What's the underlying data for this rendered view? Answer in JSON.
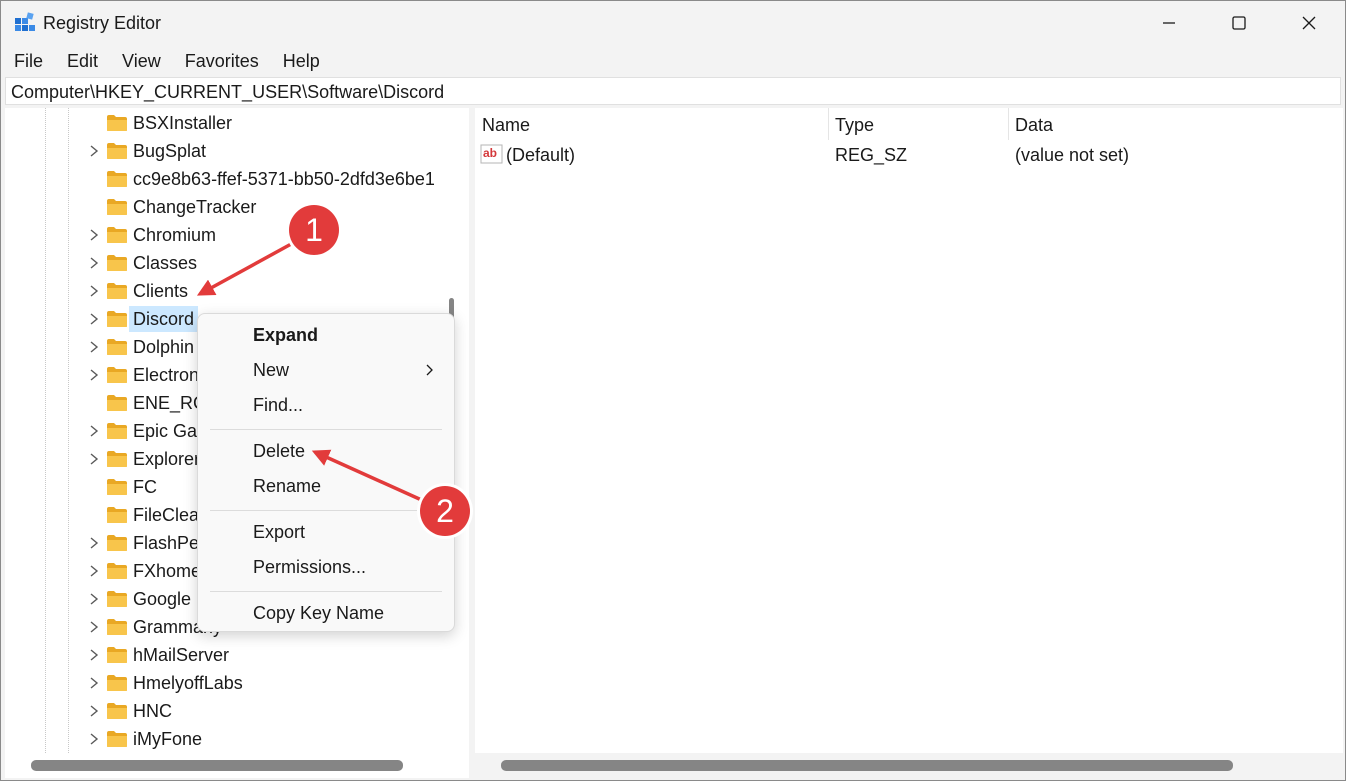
{
  "window": {
    "title": "Registry Editor",
    "controls": [
      "minimize",
      "maximize",
      "close"
    ]
  },
  "menu": [
    "File",
    "Edit",
    "View",
    "Favorites",
    "Help"
  ],
  "address": "Computer\\HKEY_CURRENT_USER\\Software\\Discord",
  "tree": {
    "items": [
      {
        "label": "BSXInstaller",
        "expandable": false,
        "selected": false
      },
      {
        "label": "BugSplat",
        "expandable": true,
        "selected": false
      },
      {
        "label": "cc9e8b63-ffef-5371-bb50-2dfd3e6be1",
        "expandable": false,
        "selected": false
      },
      {
        "label": "ChangeTracker",
        "expandable": false,
        "selected": false
      },
      {
        "label": "Chromium",
        "expandable": true,
        "selected": false
      },
      {
        "label": "Classes",
        "expandable": true,
        "selected": false
      },
      {
        "label": "Clients",
        "expandable": true,
        "selected": false
      },
      {
        "label": "Discord",
        "expandable": true,
        "selected": true
      },
      {
        "label": "Dolphin",
        "expandable": true,
        "selected": false
      },
      {
        "label": "Electron",
        "expandable": true,
        "selected": false
      },
      {
        "label": "ENE_RGB",
        "expandable": false,
        "selected": false
      },
      {
        "label": "Epic Games",
        "expandable": true,
        "selected": false
      },
      {
        "label": "Explorer",
        "expandable": true,
        "selected": false
      },
      {
        "label": "FC",
        "expandable": false,
        "selected": false
      },
      {
        "label": "FileCleaner",
        "expandable": false,
        "selected": false
      },
      {
        "label": "FlashPeak",
        "expandable": true,
        "selected": false
      },
      {
        "label": "FXhome",
        "expandable": true,
        "selected": false
      },
      {
        "label": "Google",
        "expandable": true,
        "selected": false
      },
      {
        "label": "Grammarly",
        "expandable": true,
        "selected": false
      },
      {
        "label": "hMailServer",
        "expandable": true,
        "selected": false
      },
      {
        "label": "HmelyoffLabs",
        "expandable": true,
        "selected": false
      },
      {
        "label": "HNC",
        "expandable": true,
        "selected": false
      },
      {
        "label": "iMyFone",
        "expandable": true,
        "selected": false
      }
    ]
  },
  "values": {
    "columns": [
      "Name",
      "Type",
      "Data"
    ],
    "rows": [
      {
        "name": "(Default)",
        "type": "REG_SZ",
        "data": "(value not set)"
      }
    ]
  },
  "context_menu": {
    "groups": [
      [
        {
          "label": "Expand",
          "bold": true,
          "submenu": false
        },
        {
          "label": "New",
          "bold": false,
          "submenu": true
        },
        {
          "label": "Find...",
          "bold": false,
          "submenu": false
        }
      ],
      [
        {
          "label": "Delete",
          "bold": false,
          "submenu": false
        },
        {
          "label": "Rename",
          "bold": false,
          "submenu": false
        }
      ],
      [
        {
          "label": "Export",
          "bold": false,
          "submenu": false
        },
        {
          "label": "Permissions...",
          "bold": false,
          "submenu": false
        }
      ],
      [
        {
          "label": "Copy Key Name",
          "bold": false,
          "submenu": false
        }
      ]
    ]
  },
  "annotations": [
    "1",
    "2"
  ],
  "colors": {
    "accent": "#e23b3b",
    "selection": "#cce8ff",
    "folder": "#f8c54b"
  }
}
